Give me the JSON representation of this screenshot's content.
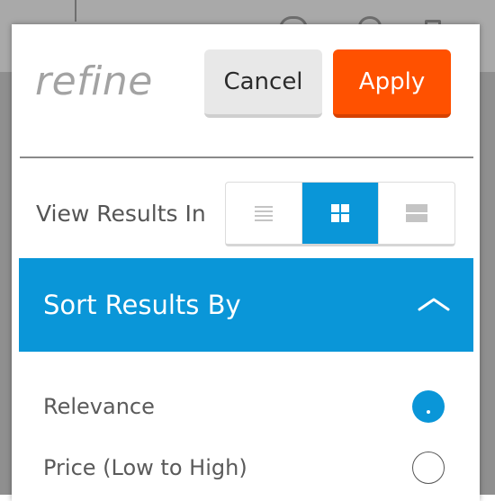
{
  "panel": {
    "title": "refine"
  },
  "buttons": {
    "cancel_label": "Cancel",
    "apply_label": "Apply"
  },
  "view_results": {
    "label": "View Results In",
    "options": [
      {
        "icon": "list-view-icon",
        "selected": false
      },
      {
        "icon": "grid-view-icon",
        "selected": true
      },
      {
        "icon": "gallery-view-icon",
        "selected": false
      }
    ]
  },
  "sort": {
    "header": "Sort Results By",
    "expanded": true,
    "options": [
      {
        "label": "Relevance",
        "selected": true
      },
      {
        "label": "Price (Low to High)",
        "selected": false
      }
    ]
  },
  "colors": {
    "accent_blue": "#0a96d8",
    "apply_orange": "#ff5100",
    "cancel_gray": "#e8e8e8"
  }
}
